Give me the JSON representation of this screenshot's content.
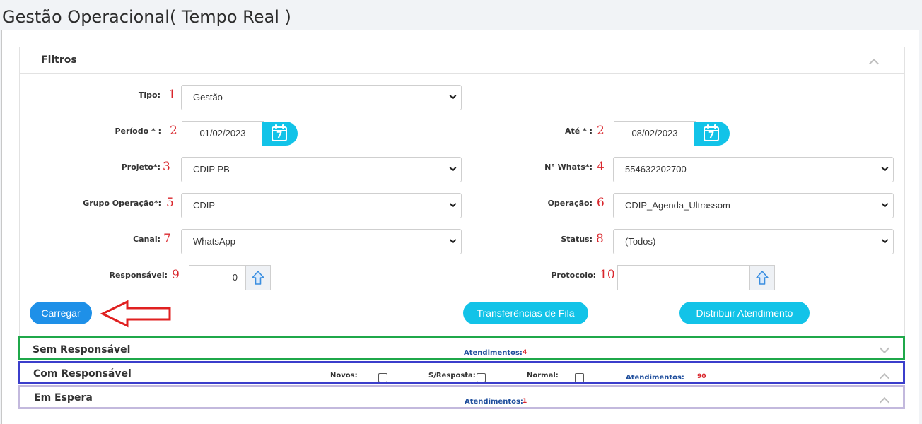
{
  "page": {
    "title": "Gestão Operacional( Tempo Real )"
  },
  "filters": {
    "title": "Filtros",
    "tipo": {
      "label": "Tipo:",
      "marker": "1",
      "value": "Gestão"
    },
    "periodo": {
      "label": "Período * :",
      "marker": "2",
      "value": "01/02/2023"
    },
    "ate": {
      "label": "Até * :",
      "marker": "2",
      "value": "08/02/2023"
    },
    "projeto": {
      "label": "Projeto*:",
      "marker": "3",
      "value": "CDIP PB"
    },
    "whats": {
      "label": "N° Whats*:",
      "marker": "4",
      "value": "554632202700"
    },
    "grupo": {
      "label": "Grupo Operação*:",
      "marker": "5",
      "value": "CDIP"
    },
    "operacao": {
      "label": "Operação:",
      "marker": "6",
      "value": "CDIP_Agenda_Ultrassom"
    },
    "canal": {
      "label": "Canal:",
      "marker": "7",
      "value": "WhatsApp"
    },
    "status": {
      "label": "Status:",
      "marker": "8",
      "value": "(Todos)"
    },
    "responsavel": {
      "label": "Responsável:",
      "marker": "9",
      "value": "0"
    },
    "protocolo": {
      "label": "Protocolo:",
      "marker": "10",
      "value": ""
    },
    "calendar_day": "7"
  },
  "buttons": {
    "carregar": "Carregar",
    "transferencias": "Transferências de Fila",
    "distribuir": "Distribuir Atendimento"
  },
  "sections": {
    "sem": {
      "title": "Sem Responsável",
      "atend_label": "Atendimentos:",
      "atend_count": "4"
    },
    "com": {
      "title": "Com Responsável",
      "novos": "Novos:",
      "sresposta": "S/Resposta:",
      "normal": "Normal:",
      "atend_label": "Atendimentos:",
      "atend_count": "90"
    },
    "espera": {
      "title": "Em Espera",
      "atend_label": "Atendimentos:",
      "atend_count": "1"
    }
  },
  "colors": {
    "accent_cyan": "#12c3e8",
    "carregar_blue": "#1e90e8",
    "marker_red": "#d9262c",
    "green_box": "#1fa84a",
    "blue_box": "#3b3ecb",
    "lavender_box": "#c3b9dd"
  },
  "icons": {
    "calendar": "calendar-icon",
    "arrow_up": "arrow-up-icon",
    "red_arrow": "red-arrow-annotation"
  }
}
